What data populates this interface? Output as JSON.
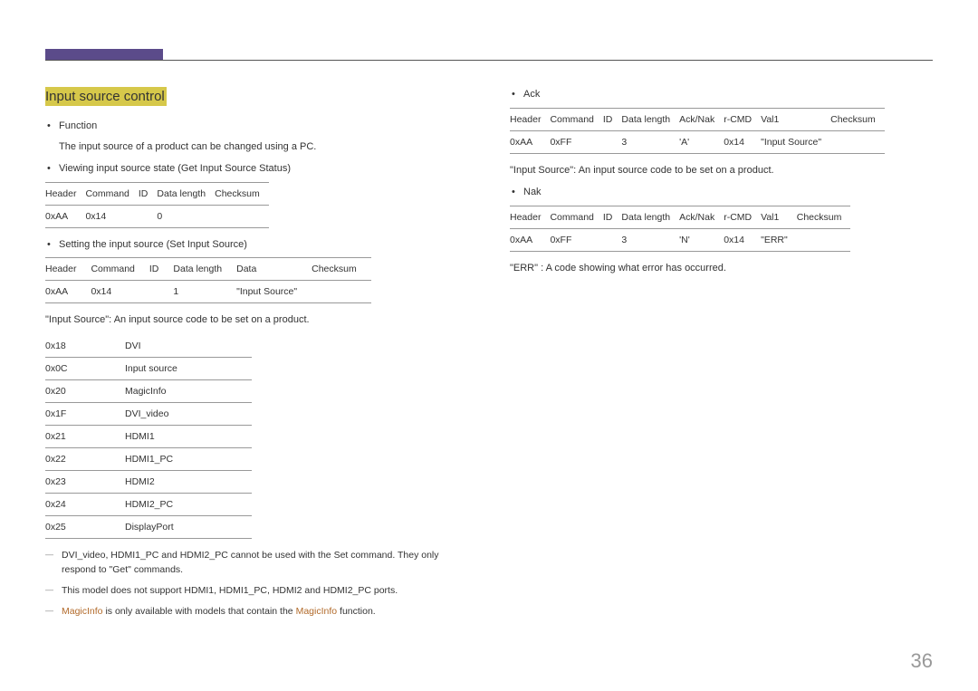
{
  "section_title": "Input source control",
  "page_number": "36",
  "left": {
    "function_label": "Function",
    "function_desc": "The input source of a product can be changed using a PC.",
    "viewing_label": "Viewing input source state (Get Input Source Status)",
    "get_headers": [
      "Header",
      "Command",
      "ID",
      "Data length",
      "Checksum"
    ],
    "get_row": [
      "0xAA",
      "0x14",
      "",
      "0",
      ""
    ],
    "setting_label": "Setting the input source (Set Input Source)",
    "set_headers": [
      "Header",
      "Command",
      "ID",
      "Data length",
      "Data",
      "Checksum"
    ],
    "set_row": [
      "0xAA",
      "0x14",
      "",
      "1",
      "\"Input Source\"",
      ""
    ],
    "input_source_desc": "\"Input Source\": An input source code to be set on a product.",
    "codes": [
      [
        "0x18",
        "DVI"
      ],
      [
        "0x0C",
        "Input source"
      ],
      [
        "0x20",
        "MagicInfo"
      ],
      [
        "0x1F",
        "DVI_video"
      ],
      [
        "0x21",
        "HDMI1"
      ],
      [
        "0x22",
        "HDMI1_PC"
      ],
      [
        "0x23",
        "HDMI2"
      ],
      [
        "0x24",
        "HDMI2_PC"
      ],
      [
        "0x25",
        "DisplayPort"
      ]
    ],
    "note1": "DVI_video, HDMI1_PC and HDMI2_PC cannot be used with the Set command. They only respond to \"Get\" commands.",
    "note2": "This model does not support HDMI1, HDMI1_PC, HDMI2 and HDMI2_PC ports.",
    "note3_a": "MagicInfo",
    "note3_b": " is only available with models that contain the ",
    "note3_c": "MagicInfo",
    "note3_d": " function."
  },
  "right": {
    "ack_label": "Ack",
    "ack_headers": [
      "Header",
      "Command",
      "ID",
      "Data length",
      "Ack/Nak",
      "r-CMD",
      "Val1",
      "Checksum"
    ],
    "ack_row": [
      "0xAA",
      "0xFF",
      "",
      "3",
      "'A'",
      "0x14",
      "\"Input Source\"",
      ""
    ],
    "ack_desc": "\"Input Source\": An input source code to be set on a product.",
    "nak_label": "Nak",
    "nak_headers": [
      "Header",
      "Command",
      "ID",
      "Data length",
      "Ack/Nak",
      "r-CMD",
      "Val1",
      "Checksum"
    ],
    "nak_row": [
      "0xAA",
      "0xFF",
      "",
      "3",
      "'N'",
      "0x14",
      "\"ERR\"",
      ""
    ],
    "err_desc": "\"ERR\" : A code showing what error has occurred."
  }
}
